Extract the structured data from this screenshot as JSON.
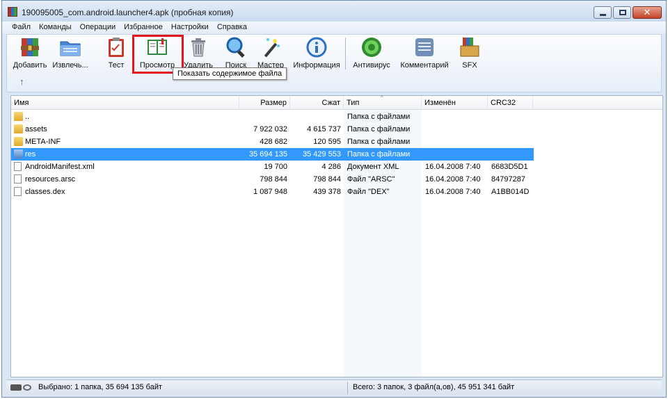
{
  "window": {
    "title": "190095005_com.android.launcher4.apk (пробная копия)"
  },
  "menu": [
    "Файл",
    "Команды",
    "Операции",
    "Избранное",
    "Настройки",
    "Справка"
  ],
  "toolbar": {
    "buttons": [
      {
        "label": "Добавить",
        "icon": "add-archive-icon"
      },
      {
        "label": "Извлечь...",
        "icon": "extract-folder-icon"
      },
      {
        "label": "Тест",
        "icon": "test-clipboard-icon"
      },
      {
        "label": "Просмотр",
        "icon": "view-book-icon"
      },
      {
        "label": "Удалить",
        "icon": "delete-trash-icon"
      },
      {
        "label": "Поиск",
        "icon": "search-magnifier-icon"
      },
      {
        "label": "Мастер",
        "icon": "wizard-wand-icon"
      },
      {
        "label": "Информация",
        "icon": "info-icon"
      },
      {
        "label": "Антивирус",
        "icon": "antivirus-icon"
      },
      {
        "label": "Комментарий",
        "icon": "comment-icon"
      },
      {
        "label": "SFX",
        "icon": "sfx-box-icon"
      }
    ],
    "tooltip": "Показать содержимое файла"
  },
  "columns": [
    "Имя",
    "Размер",
    "Сжат",
    "Тип",
    "Изменён",
    "CRC32"
  ],
  "files": [
    {
      "name": "..",
      "size": "",
      "packed": "",
      "type": "Папка с файлами",
      "modified": "",
      "crc": "",
      "kind": "folder"
    },
    {
      "name": "assets",
      "size": "7 922 032",
      "packed": "4 615 737",
      "type": "Папка с файлами",
      "modified": "",
      "crc": "",
      "kind": "folder"
    },
    {
      "name": "META-INF",
      "size": "428 682",
      "packed": "120 595",
      "type": "Папка с файлами",
      "modified": "",
      "crc": "",
      "kind": "folder"
    },
    {
      "name": "res",
      "size": "35 694 135",
      "packed": "35 429 553",
      "type": "Папка с файлами",
      "modified": "",
      "crc": "",
      "kind": "folder-selected"
    },
    {
      "name": "AndroidManifest.xml",
      "size": "19 700",
      "packed": "4 286",
      "type": "Документ XML",
      "modified": "16.04.2008 7:40",
      "crc": "6683D5D1",
      "kind": "xml"
    },
    {
      "name": "resources.arsc",
      "size": "798 844",
      "packed": "798 844",
      "type": "Файл \"ARSC\"",
      "modified": "16.04.2008 7:40",
      "crc": "84797287",
      "kind": "file"
    },
    {
      "name": "classes.dex",
      "size": "1 087 948",
      "packed": "439 378",
      "type": "Файл \"DEX\"",
      "modified": "16.04.2008 7:40",
      "crc": "A1BB014D",
      "kind": "file"
    }
  ],
  "status": {
    "left": "Выбрано: 1 папка, 35 694 135 байт",
    "right": "Всего: 3 папок, 3 файл(а,ов), 45 951 341 байт"
  },
  "colors": {
    "selection": "#3399ff",
    "highlight": "#e3161c"
  }
}
